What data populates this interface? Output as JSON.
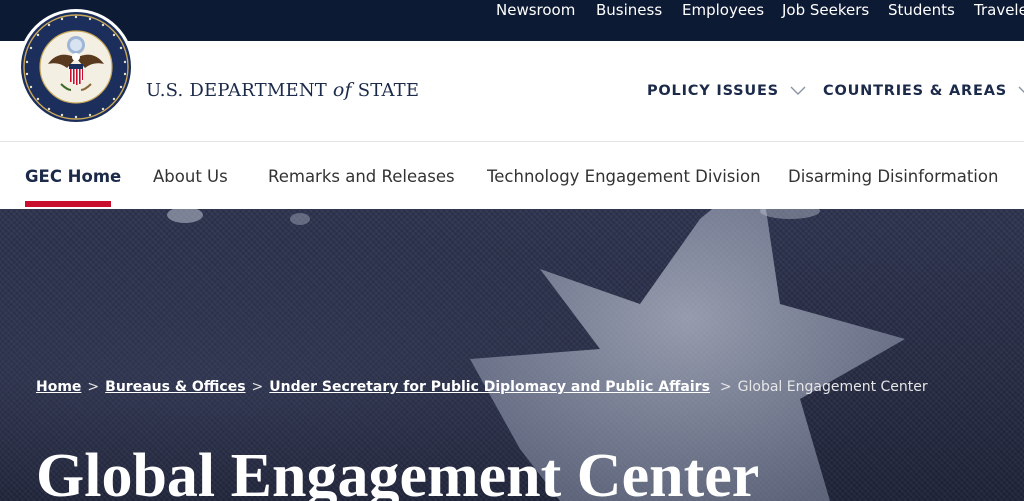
{
  "utility_nav": {
    "items": [
      "Newsroom",
      "Business",
      "Employees",
      "Job Seekers",
      "Students",
      "Travele"
    ]
  },
  "header": {
    "seal_label": "Seal of the U.S. Department of State",
    "wordmark_prefix": "U.S. DEPARTMENT",
    "wordmark_of": "of",
    "wordmark_suffix": "STATE",
    "main_nav": [
      "POLICY ISSUES",
      "COUNTRIES & AREAS"
    ]
  },
  "subnav": {
    "items": [
      "GEC Home",
      "About Us",
      "Remarks and Releases",
      "Technology Engagement Division",
      "Disarming Disinformation"
    ],
    "active": "GEC Home"
  },
  "breadcrumb": {
    "links": [
      "Home",
      "Bureaus & Offices",
      "Under Secretary for Public Diplomacy and Public Affairs"
    ],
    "separator": ">",
    "current": "Global Engagement Center"
  },
  "hero": {
    "title": "Global Engagement Center"
  },
  "colors": {
    "utility_bg": "#0d1a33",
    "navy_text": "#1c2a4a",
    "active_underline": "#c8102e"
  }
}
